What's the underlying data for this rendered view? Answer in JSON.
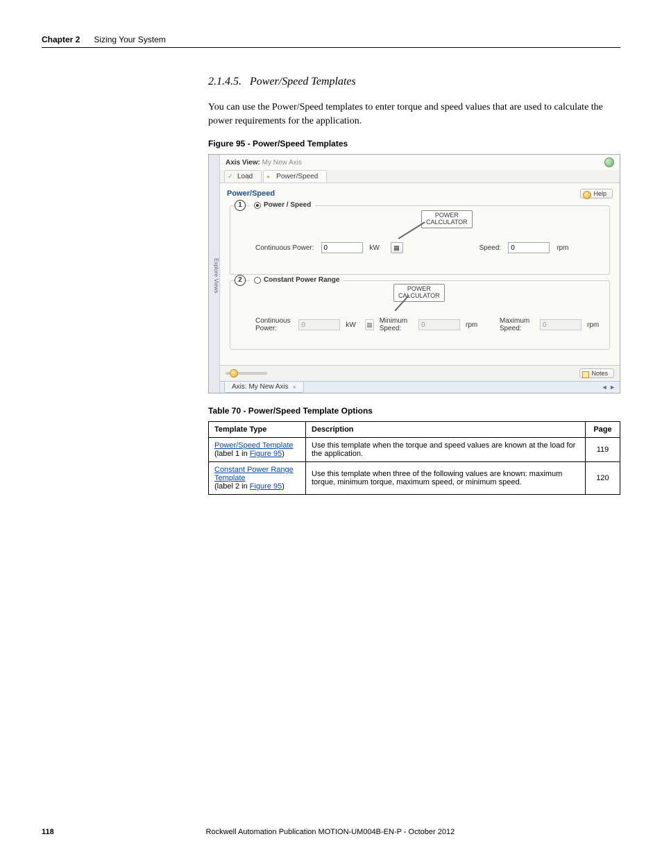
{
  "header": {
    "chapter_label": "Chapter 2",
    "chapter_title": "Sizing Your System"
  },
  "section": {
    "number": "2.1.4.5.",
    "title": "Power/Speed Templates",
    "body": "You can use the Power/Speed templates to enter torque and speed values that are used to calculate the power requirements for the application."
  },
  "figure": {
    "caption": "Figure 95 - Power/Speed Templates"
  },
  "screenshot": {
    "sidebar_label": "Explore Views",
    "axis_view_label": "Axis View:",
    "axis_view_value": "My New Axis",
    "tabs": [
      {
        "label": "Load",
        "state": "check"
      },
      {
        "label": "Power/Speed",
        "state": "dot"
      }
    ],
    "panel_title": "Power/Speed",
    "help_btn": "Help",
    "group1": {
      "callout": "1",
      "legend": "Power / Speed",
      "calc_label_l1": "POWER",
      "calc_label_l2": "CALCULATOR",
      "cont_power_label": "Continuous Power:",
      "cont_power_value": "0",
      "cont_power_unit": "kW",
      "speed_label": "Speed:",
      "speed_value": "0",
      "speed_unit": "rpm"
    },
    "group2": {
      "callout": "2",
      "legend": "Constant Power Range",
      "calc_label_l1": "POWER",
      "calc_label_l2": "CALCULATOR",
      "cont_power_label": "Continuous Power:",
      "cont_power_value": "0",
      "cont_power_unit": "kW",
      "min_speed_label": "Minimum Speed:",
      "min_speed_value": "0",
      "min_speed_unit": "rpm",
      "max_speed_label": "Maximum Speed:",
      "max_speed_value": "0",
      "max_speed_unit": "rpm"
    },
    "notes_btn": "Notes",
    "bottom_tab": "Axis: My New Axis",
    "bottom_tab_close": "×",
    "nav_arrows": "◄ ►"
  },
  "table": {
    "caption": "Table 70 - Power/Speed Template Options",
    "headers": [
      "Template Type",
      "Description",
      "Page"
    ],
    "rows": [
      {
        "type_link": "Power/Speed Template",
        "type_ref_prefix": "(label 1 in ",
        "type_ref_link": "Figure 95",
        "type_ref_suffix": ")",
        "desc": "Use this template when the torque and speed values are known at the load for the application.",
        "page": "119"
      },
      {
        "type_link": "Constant Power Range Template",
        "type_ref_prefix": "(label 2 in ",
        "type_ref_link": "Figure 95",
        "type_ref_suffix": ")",
        "desc": "Use this template when three of the following values are known: maximum torque, minimum torque, maximum speed, or minimum speed.",
        "page": "120"
      }
    ]
  },
  "footer": {
    "page": "118",
    "pub": "Rockwell Automation Publication MOTION-UM004B-EN-P - October 2012"
  }
}
